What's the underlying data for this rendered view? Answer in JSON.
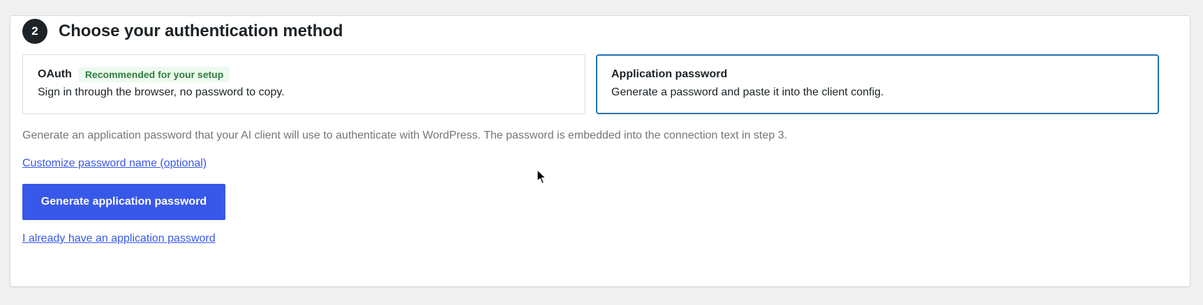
{
  "step": {
    "number": "2",
    "title": "Choose your authentication method"
  },
  "options": [
    {
      "title": "OAuth",
      "badge": "Recommended for your setup",
      "description": "Sign in through the browser, no password to copy.",
      "selected": false
    },
    {
      "title": "Application password",
      "description": "Generate a password and paste it into the client config.",
      "selected": true
    }
  ],
  "help_text": "Generate an application password that your AI client will use to authenticate with WordPress. The password is embedded into the connection text in step 3.",
  "customize_link": "Customize password name (optional)",
  "generate_button": "Generate application password",
  "existing_link": "I already have an application password",
  "colors": {
    "accent": "#3858e9",
    "selected_border": "#2271b1",
    "badge_text": "#2e7d3e",
    "badge_bg": "#edfaef"
  }
}
